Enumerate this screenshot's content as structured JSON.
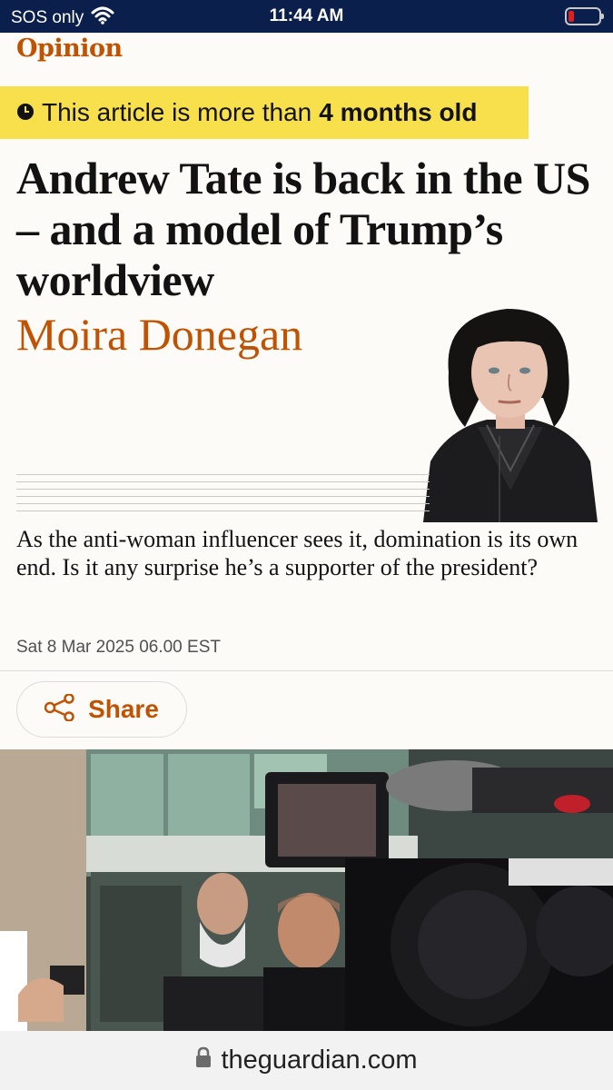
{
  "status_bar": {
    "carrier": "SOS only",
    "time": "11:44 AM",
    "battery_level": 0.1
  },
  "article": {
    "section": "Opinion",
    "age_notice_prefix": "This article is more than",
    "age_notice_bold": "4 months old",
    "headline": "Andrew Tate is back in the US – and a model of Trump’s worldview",
    "author": "Moira Donegan",
    "standfirst": "As the anti-woman influencer sees it, domination is its own end. Is it any surprise he’s a supporter of the president?",
    "date": "Sat 8 Mar 2025 06.00 EST",
    "share_label": "Share"
  },
  "browser": {
    "url": "theguardian.com"
  },
  "colors": {
    "status_bar_bg": "#0b1f4d",
    "accent": "#c05303",
    "banner_yellow": "#f7e04b",
    "page_bg": "#fdfbf7"
  },
  "icons": [
    "wifi-icon",
    "battery-icon",
    "clock-icon",
    "share-icon",
    "lock-icon"
  ]
}
